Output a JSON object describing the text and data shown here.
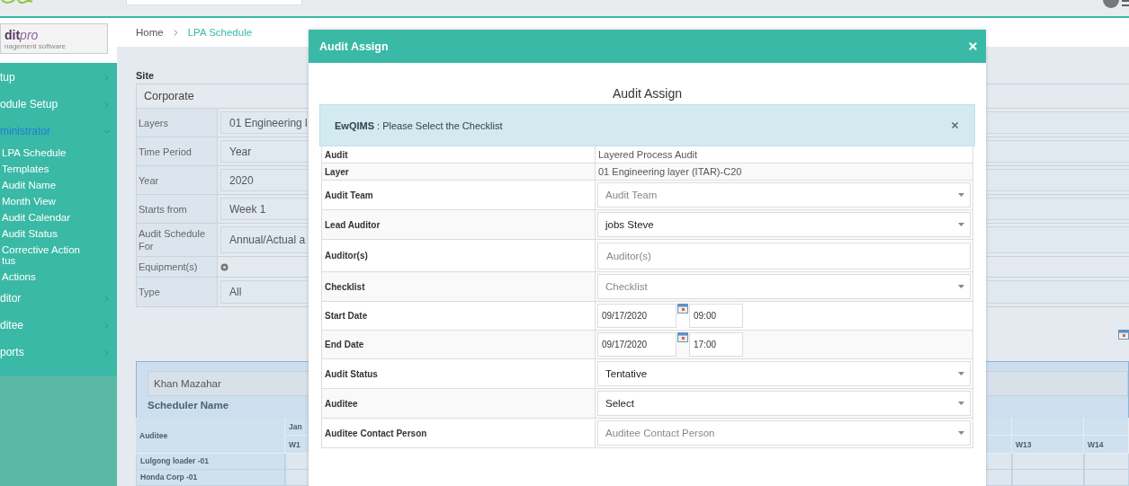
{
  "sidebar": {
    "logo": {
      "name": "dit",
      "suffix": "pro",
      "tagline": "nagement software"
    },
    "items": [
      {
        "label": "tup",
        "expanded": false
      },
      {
        "label": "odule Setup",
        "expanded": false
      },
      {
        "label": "ministrator",
        "expanded": true,
        "children": [
          "LPA Schedule",
          "Templates",
          "Audit Name",
          "Month View",
          "Audit Calendar",
          "Audit Status",
          "Corrective Action tus",
          "Actions"
        ]
      },
      {
        "label": "ditor",
        "expanded": false
      },
      {
        "label": "ditee",
        "expanded": false
      },
      {
        "label": "ports",
        "expanded": false
      }
    ]
  },
  "breadcrumb": [
    "Home",
    "LPA Schedule"
  ],
  "filters": {
    "site_label": "Site",
    "site": "Corporate",
    "rows": [
      {
        "label": "Layers",
        "kind": "field",
        "value": "01 Engineering l"
      },
      {
        "label": "Time Period",
        "kind": "field",
        "value": "Year"
      },
      {
        "label": "Year",
        "kind": "field",
        "value": "2020"
      },
      {
        "label": "Starts from",
        "kind": "field",
        "value": "Week 1"
      },
      {
        "label": "Audit Schedule For",
        "kind": "field",
        "value": "Annual/Actual a"
      },
      {
        "label": "Equipment(s)",
        "kind": "icon"
      },
      {
        "label": "Type",
        "kind": "field",
        "value": "All"
      }
    ]
  },
  "scheduler": {
    "value": "Khan Mazahar",
    "label": "Scheduler Name"
  },
  "schedule_table": {
    "auditee_header": "Auditee",
    "month": "Jan",
    "first_week": "W1",
    "right_weeks": [
      "W13",
      "W14"
    ],
    "rows": [
      "Lulgong loader -01",
      "Honda Corp -01"
    ]
  },
  "modal": {
    "title": "Audit Assign",
    "heading": "Audit Assign",
    "alert": "**EwQIMS** : Please Select the Checklist",
    "fields": [
      {
        "label": "Audit",
        "kind": "text",
        "value": "Layered Process Audit"
      },
      {
        "label": "Layer",
        "kind": "text",
        "value": "01 Engineering layer (ITAR)-C20"
      },
      {
        "label": "Audit Team",
        "kind": "select",
        "placeholder": "Audit Team"
      },
      {
        "label": "Lead Auditor",
        "kind": "select",
        "value": "jobs Steve"
      },
      {
        "label": "Auditor(s)",
        "kind": "input",
        "placeholder": "Auditor(s)"
      },
      {
        "label": "Checklist",
        "kind": "select",
        "placeholder": "Checklist"
      },
      {
        "label": "Start Date",
        "kind": "datetime",
        "date": "09/17/2020",
        "time": "09:00"
      },
      {
        "label": "End Date",
        "kind": "datetime",
        "date": "09/17/2020",
        "time": "17:00"
      },
      {
        "label": "Audit Status",
        "kind": "select",
        "value": "Tentative"
      },
      {
        "label": "Auditee",
        "kind": "select",
        "value": "Select"
      },
      {
        "label": "Auditee Contact Person",
        "kind": "select",
        "placeholder": "Auditee Contact Person"
      }
    ]
  }
}
